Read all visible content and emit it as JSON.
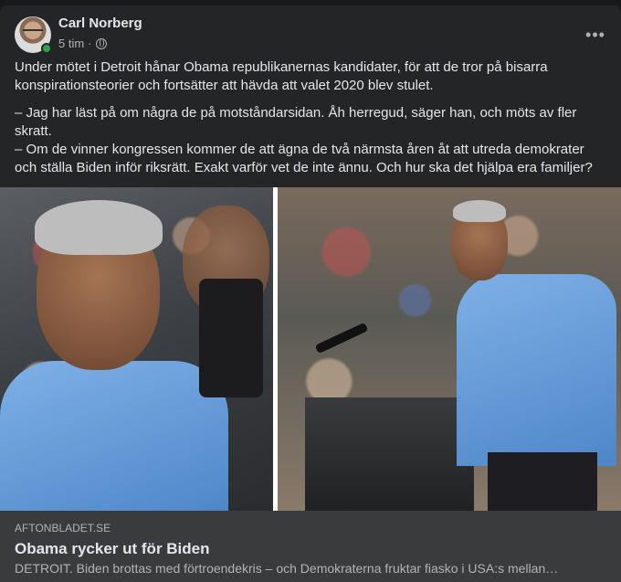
{
  "post": {
    "author": "Carl Norberg",
    "time": "5 tim",
    "separator": "·",
    "more_label": "•••",
    "paragraphs": [
      "Under mötet i Detroit hånar Obama republikanernas kandidater, för att de tror på bisarra konspirationsteorier och fortsätter att hävda att valet 2020 blev stulet.",
      "– Jag har läst på om några de på motståndarsidan. Åh herregud, säger han, och möts av fler skratt.",
      "– Om de vinner kongressen kommer de att ägna de två närmsta åren åt att utreda demokrater och ställa Biden inför riksrätt. Exakt varför vet de inte ännu. Och hur ska det hjälpa era familjer?"
    ],
    "audience_icon": "globe-icon"
  },
  "link": {
    "domain": "AFTONBLADET.SE",
    "title": "Obama rycker ut för Biden",
    "description": "DETROIT. Biden brottas med förtroendekris – och Demokraterna fruktar fiasko i USA:s mellan…"
  },
  "colors": {
    "background": "#18191a",
    "card": "#242526",
    "link_card": "#3a3b3c",
    "primary_text": "#e4e6eb",
    "secondary_text": "#b0b3b8",
    "online": "#31a24c"
  }
}
